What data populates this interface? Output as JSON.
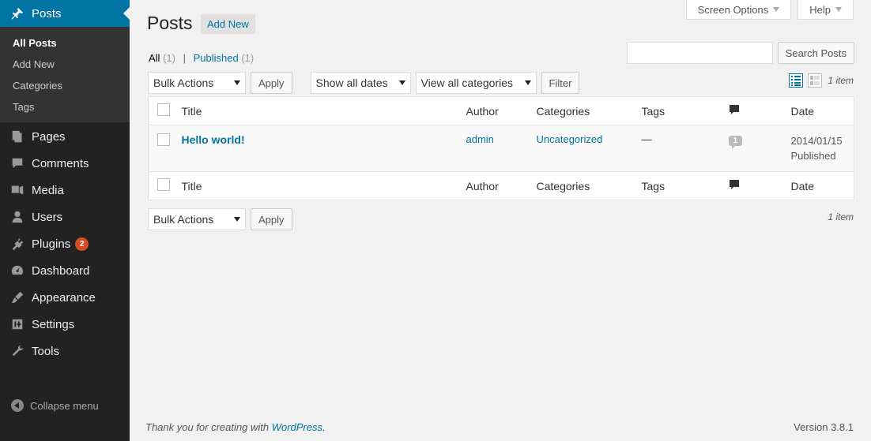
{
  "sidebar": {
    "current": {
      "label": "Posts",
      "icon": "pushpin-icon"
    },
    "submenu": [
      {
        "label": "All Posts",
        "active": true
      },
      {
        "label": "Add New"
      },
      {
        "label": "Categories"
      },
      {
        "label": "Tags"
      }
    ],
    "items": [
      {
        "label": "Pages",
        "icon": "pages-icon"
      },
      {
        "label": "Comments",
        "icon": "comments-icon"
      },
      {
        "label": "Media",
        "icon": "media-icon"
      },
      {
        "label": "Users",
        "icon": "users-icon"
      },
      {
        "label": "Plugins",
        "icon": "plugins-icon",
        "badge": "2"
      },
      {
        "label": "Dashboard",
        "icon": "dashboard-icon"
      },
      {
        "label": "Appearance",
        "icon": "appearance-icon"
      },
      {
        "label": "Settings",
        "icon": "settings-icon"
      },
      {
        "label": "Tools",
        "icon": "tools-icon"
      }
    ],
    "collapse_label": "Collapse menu"
  },
  "screen_options": {
    "screen_options_label": "Screen Options",
    "help_label": "Help"
  },
  "header": {
    "title": "Posts",
    "add_new_label": "Add New"
  },
  "filters": {
    "all_label": "All",
    "all_count": "(1)",
    "separator": "|",
    "published_label": "Published",
    "published_count": "(1)"
  },
  "search": {
    "button_label": "Search Posts",
    "value": ""
  },
  "tablenav_top": {
    "bulk_actions": "Bulk Actions",
    "apply_label": "Apply",
    "dates_select": "Show all dates",
    "categories_select": "View all categories",
    "filter_label": "Filter",
    "items_count": "1 item"
  },
  "table": {
    "columns": {
      "title": "Title",
      "author": "Author",
      "categories": "Categories",
      "tags": "Tags",
      "date": "Date"
    },
    "rows": [
      {
        "title": "Hello world!",
        "author": "admin",
        "categories": "Uncategorized",
        "tags": "—",
        "comments": "1",
        "date": "2014/01/15",
        "status": "Published"
      }
    ]
  },
  "tablenav_bottom": {
    "bulk_actions": "Bulk Actions",
    "apply_label": "Apply",
    "items_count": "1 item"
  },
  "footer": {
    "thanks_text": "Thank you for creating with",
    "wordpress_link": "WordPress",
    "period": ".",
    "version": "Version 3.8.1"
  },
  "colors": {
    "sidebar_bg": "#222222",
    "accent": "#0074a2",
    "badge": "#d54e21"
  }
}
